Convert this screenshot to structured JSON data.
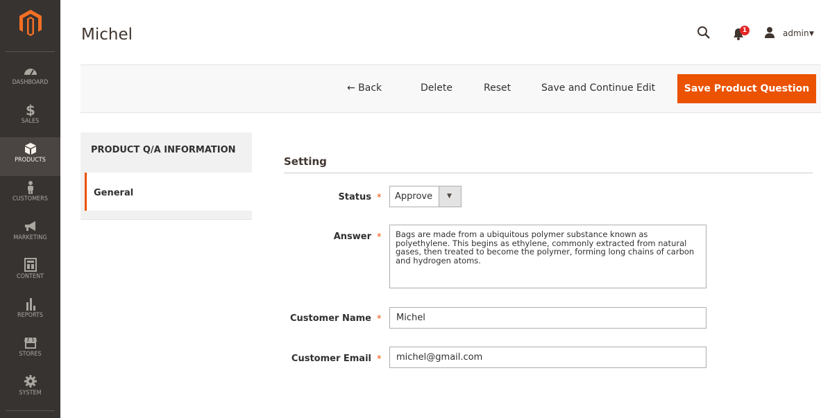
{
  "menu": {
    "items": [
      {
        "label": "DASHBOARD",
        "icon": "dashboard-icon"
      },
      {
        "label": "SALES",
        "icon": "dollar-icon"
      },
      {
        "label": "PRODUCTS",
        "icon": "box-icon"
      },
      {
        "label": "CUSTOMERS",
        "icon": "person-icon"
      },
      {
        "label": "MARKETING",
        "icon": "megaphone-icon"
      },
      {
        "label": "CONTENT",
        "icon": "layout-icon"
      },
      {
        "label": "REPORTS",
        "icon": "bar-chart-icon"
      },
      {
        "label": "STORES",
        "icon": "storefront-icon"
      },
      {
        "label": "SYSTEM",
        "icon": "gear-icon"
      }
    ],
    "active": "PRODUCTS",
    "accent": "#eb5202"
  },
  "header": {
    "title": "Michel",
    "notification_count": "1",
    "user": "admin"
  },
  "actions": {
    "back": "← Back",
    "delete": "Delete",
    "reset": "Reset",
    "save_continue": "Save and Continue Edit",
    "save": "Save Product Question"
  },
  "tabs": {
    "title": "PRODUCT Q/A INFORMATION",
    "items": [
      {
        "label": "General"
      }
    ]
  },
  "form": {
    "fieldset_title": "Setting",
    "status": {
      "label": "Status",
      "value": "Approve"
    },
    "answer": {
      "label": "Answer",
      "value": "Bags are made from a ubiquitous polymer substance known as polyethylene. This begins as ethylene, commonly extracted from natural gases, then treated to become the polymer, forming long chains of carbon and hydrogen atoms."
    },
    "customer_name": {
      "label": "Customer Name",
      "value": "Michel"
    },
    "customer_email": {
      "label": "Customer Email",
      "value": "michel@gmail.com"
    },
    "required_mark": "*"
  }
}
